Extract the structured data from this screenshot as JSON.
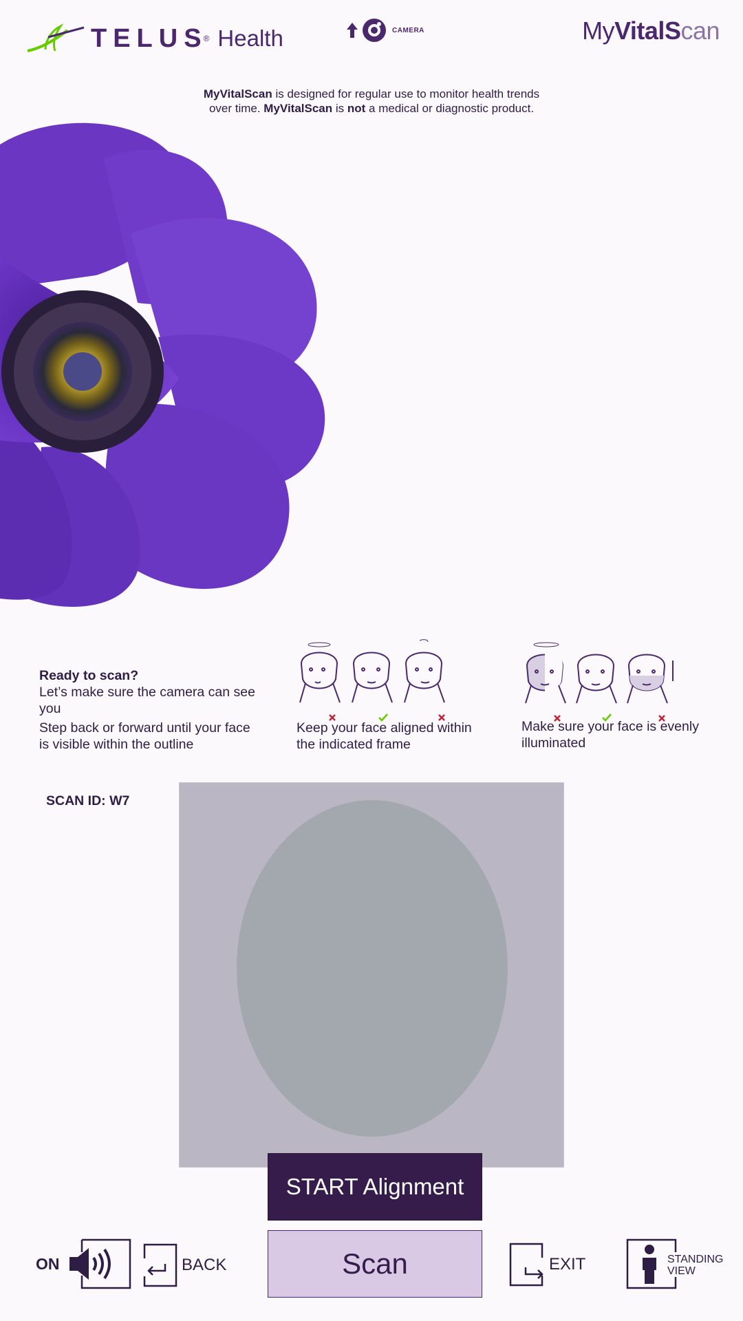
{
  "header": {
    "brand_word": "TELUS",
    "brand_reg": "®",
    "brand_sub": "Health",
    "camera_label": "CAMERA",
    "app_logo": {
      "my": "My",
      "vital": "VitalS",
      "scan": "can"
    }
  },
  "disclaimer": {
    "line1_bold": "MyVitalScan",
    "line1_rest": " is designed for regular use to monitor health trends",
    "line2_start": "over time. ",
    "line2_bold": "MyVitalScan",
    "line2_mid": " is ",
    "line2_not": "not",
    "line2_end": " a medical or diagnostic product."
  },
  "instructions": {
    "title": "Ready to scan?",
    "line1": "Let’s make sure the camera can see you",
    "line2": "Step back or forward until your face is visible within the outline",
    "align_caption": "Keep your face aligned within the indicated frame",
    "light_caption": "Make sure your face is evenly illuminated"
  },
  "scan": {
    "scan_id_label": "SCAN ID: W7",
    "start_button": "START Alignment",
    "scan_button": "Scan"
  },
  "controls": {
    "sound_state": "ON",
    "back_label": "BACK",
    "exit_label": "EXIT",
    "standing_line1": "STANDING",
    "standing_line2": "VIEW"
  },
  "colors": {
    "brand_purple": "#4b286d",
    "dark_purple": "#351c4b",
    "light_purple": "#d9c9e4",
    "check_green": "#66cc00",
    "cross_red": "#c12335"
  }
}
